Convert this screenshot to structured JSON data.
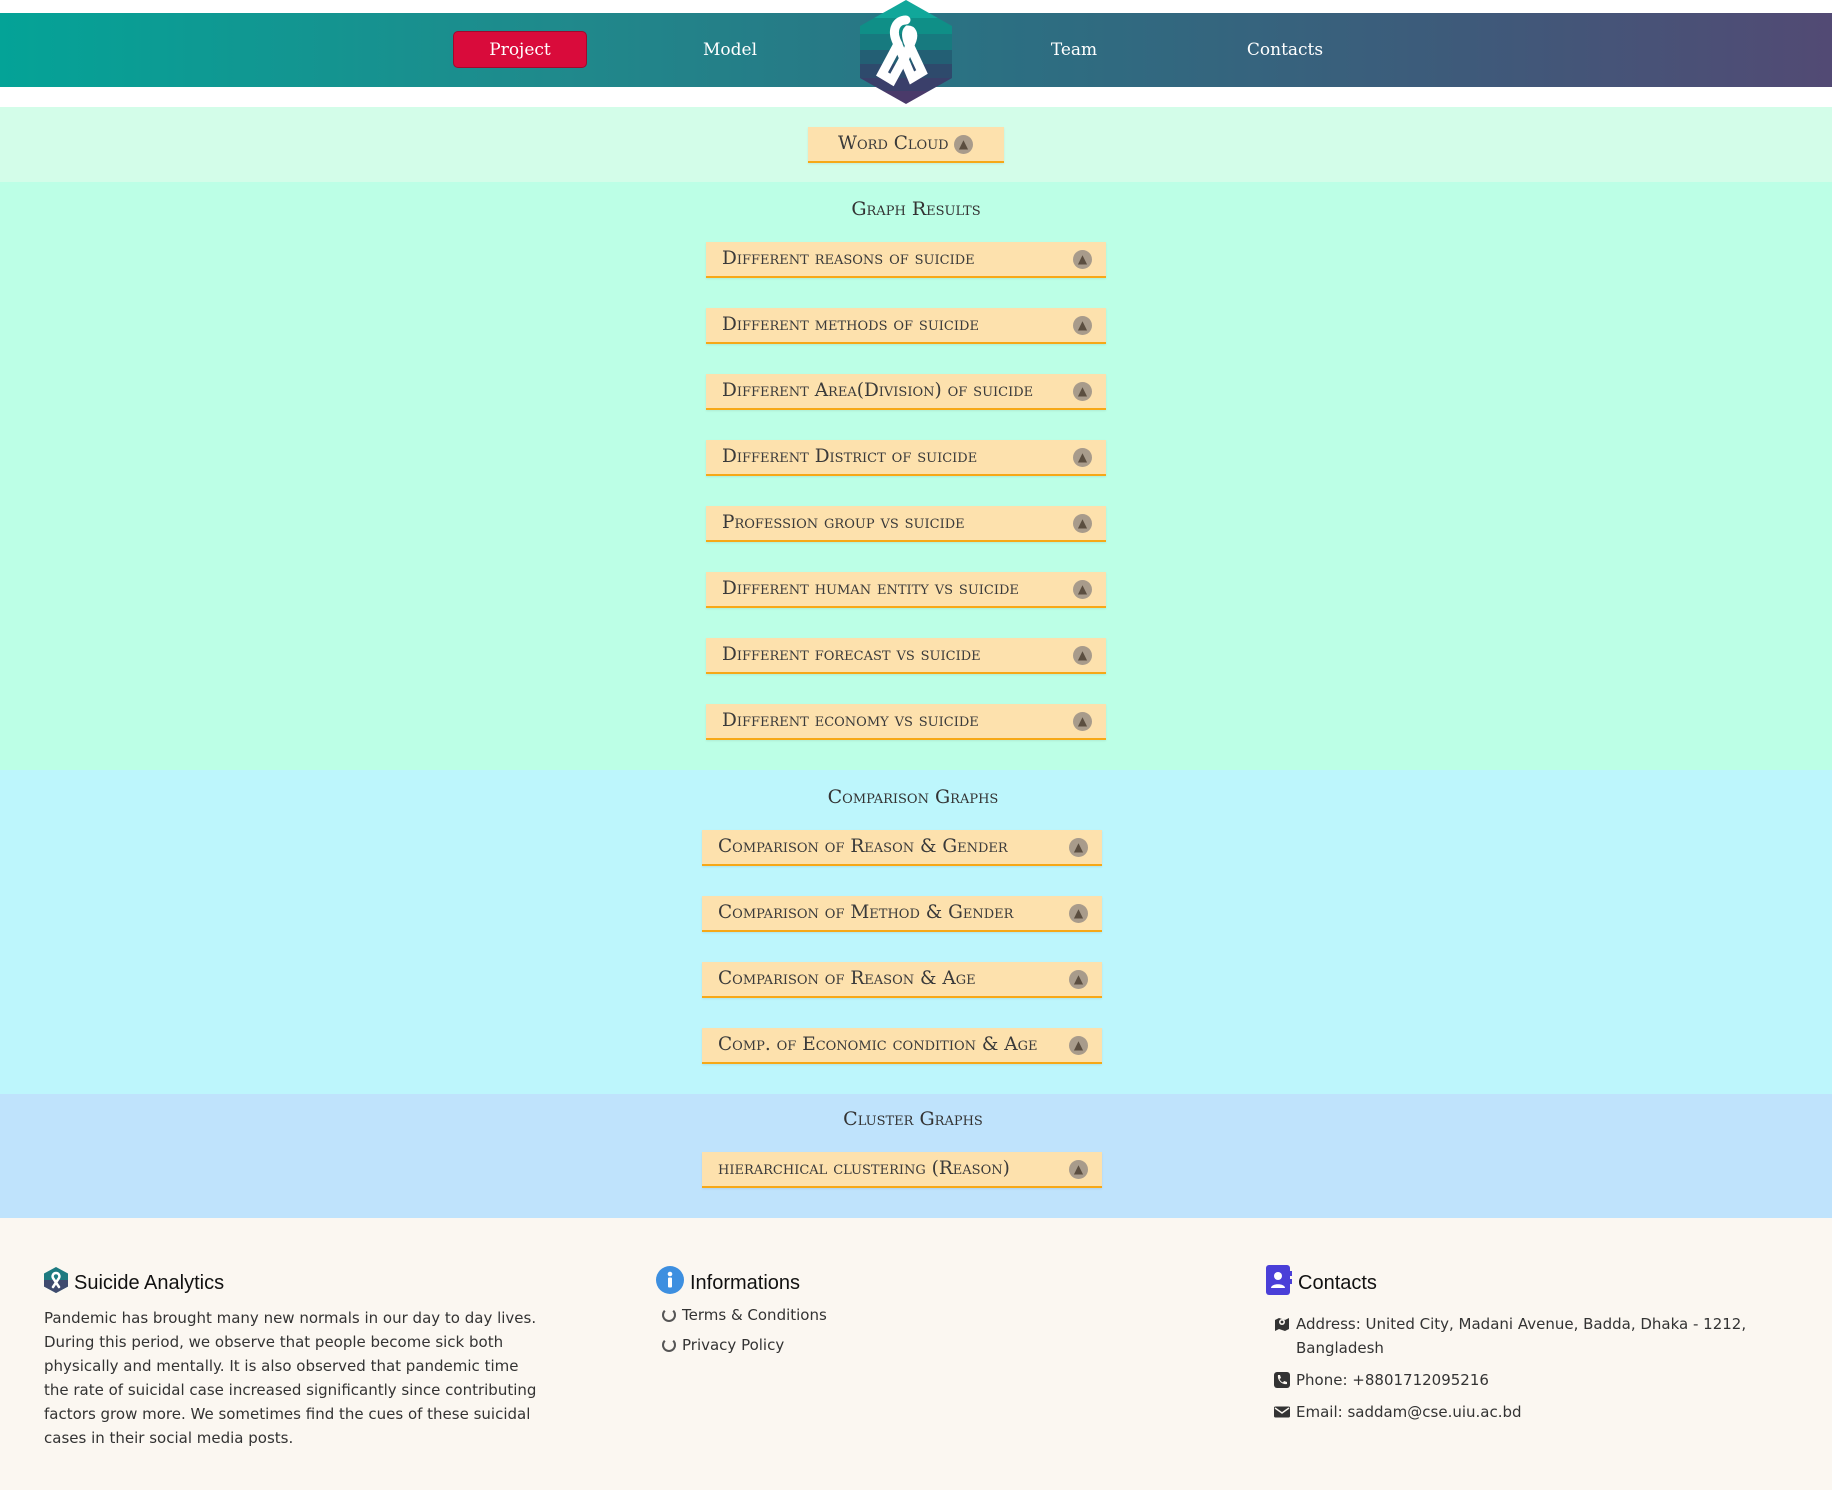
{
  "nav": {
    "items": [
      "Project",
      "Model",
      "Team",
      "Contacts"
    ],
    "active_color": "#d90b3b"
  },
  "wordcloud": {
    "label": "Word Cloud"
  },
  "graph_results": {
    "title": "Graph Results",
    "items": [
      "Different reasons of suicide",
      "Different methods of suicide",
      "Different Area(Division) of suicide",
      "Different District of suicide",
      "Profession group vs suicide",
      "Different human entity vs suicide",
      "Different forecast vs suicide",
      "Different economy vs suicide"
    ]
  },
  "comparison": {
    "title": "Comparison Graphs",
    "items": [
      "Comparison of Reason & Gender",
      "Comparison of Method & Gender",
      "Comparison of Reason & Age",
      "Comp. of Economic condition & Age"
    ]
  },
  "cluster": {
    "title": "Cluster Graphs",
    "items": [
      "hierarchical clustering (Reason)"
    ]
  },
  "footer": {
    "about": {
      "title": "Suicide Analytics",
      "text": "Pandemic has brought many new normals in our day to day lives. During this period, we observe that people become sick both physically and mentally. It is also observed that pandemic time the rate of suicidal case increased significantly since contributing factors grow more. We sometimes find the cues of these suicidal cases in their social media posts."
    },
    "info": {
      "title": "Informations",
      "links": [
        "Terms & Conditions",
        "Privacy Policy"
      ]
    },
    "contacts": {
      "title": "Contacts",
      "address": "Address: United City, Madani Avenue, Badda, Dhaka - 1212, Bangladesh",
      "phone": "Phone: +8801712095216",
      "email": "Email: saddam@cse.uiu.ac.bd"
    }
  },
  "icons": {
    "logo": "awareness-ribbon-hexagon",
    "pill_arrow": "arrow-up-circle-icon"
  }
}
